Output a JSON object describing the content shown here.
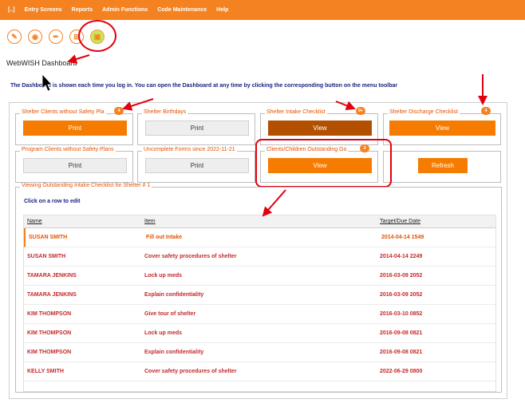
{
  "menu": [
    "[..]",
    "Entry Screens",
    "Reports",
    "Admin Functions",
    "Code Maintenance",
    "Help"
  ],
  "toolbar": {
    "icons": [
      "pencil-icon",
      "bandage-icon",
      "feather-icon",
      "trash-icon",
      "dashboard-icon"
    ],
    "glyphs": [
      "✎",
      "◉",
      "✒",
      "⊞",
      "▣"
    ]
  },
  "page": {
    "title": "WebWISH Dashboard",
    "intro": "The Dashboard is shown each time you log in. You can open the Dashboard at any time by clicking the corresponding button on the menu toolbar"
  },
  "cards": [
    {
      "legend": "Shelter Clients without Safety Pla",
      "button": "Print",
      "badge": "4"
    },
    {
      "legend": "Shelter Birthdays",
      "button": "Print",
      "badge": ""
    },
    {
      "legend": "Shelter Intake Checklist",
      "button": "View",
      "badge": "9+"
    },
    {
      "legend": "Shelter Discharge Checklist",
      "button": "View",
      "badge": "4"
    },
    {
      "legend": "Program Clients without Safety Plans",
      "button": "Print",
      "badge": ""
    },
    {
      "legend": "Uncomplete Forms since 2022-11-21",
      "button": "Print",
      "badge": ""
    },
    {
      "legend": "Clients/Children Outstanding Go",
      "button": "View",
      "badge": "3"
    },
    {
      "legend": "",
      "button": "Refresh",
      "badge": ""
    }
  ],
  "table": {
    "legend": "Viewing Outstanding Intake Checklist for Shelter # 1",
    "hint": "Click on a row to edit",
    "headers": {
      "name": "Name",
      "item": "Item",
      "target": "Target/Due Date"
    },
    "rows": [
      {
        "name": "SUSAN SMITH",
        "item": "Fill out Intake",
        "target": "2014-04-14 1549"
      },
      {
        "name": "SUSAN SMITH",
        "item": "Cover safety procedures of shelter",
        "target": "2014-04-14 2249"
      },
      {
        "name": "TAMARA JENKINS",
        "item": "Lock up meds",
        "target": "2016-03-09 2052"
      },
      {
        "name": "TAMARA JENKINS",
        "item": "Explain confidentiality",
        "target": "2016-03-09 2052"
      },
      {
        "name": "KIM THOMPSON",
        "item": "Give tour of shelter",
        "target": "2016-03-10 0852"
      },
      {
        "name": "KIM THOMPSON",
        "item": "Lock up meds",
        "target": "2016-09-08 0821"
      },
      {
        "name": "KIM THOMPSON",
        "item": "Explain confidentiality",
        "target": "2016-09-08 0821"
      },
      {
        "name": "KELLY SMITH",
        "item": "Cover safety procedures of shelter",
        "target": "2022-06-29 0800"
      }
    ]
  },
  "colors": {
    "brand": "#f58220",
    "annotation": "#e2000f",
    "link": "#1a237e"
  }
}
